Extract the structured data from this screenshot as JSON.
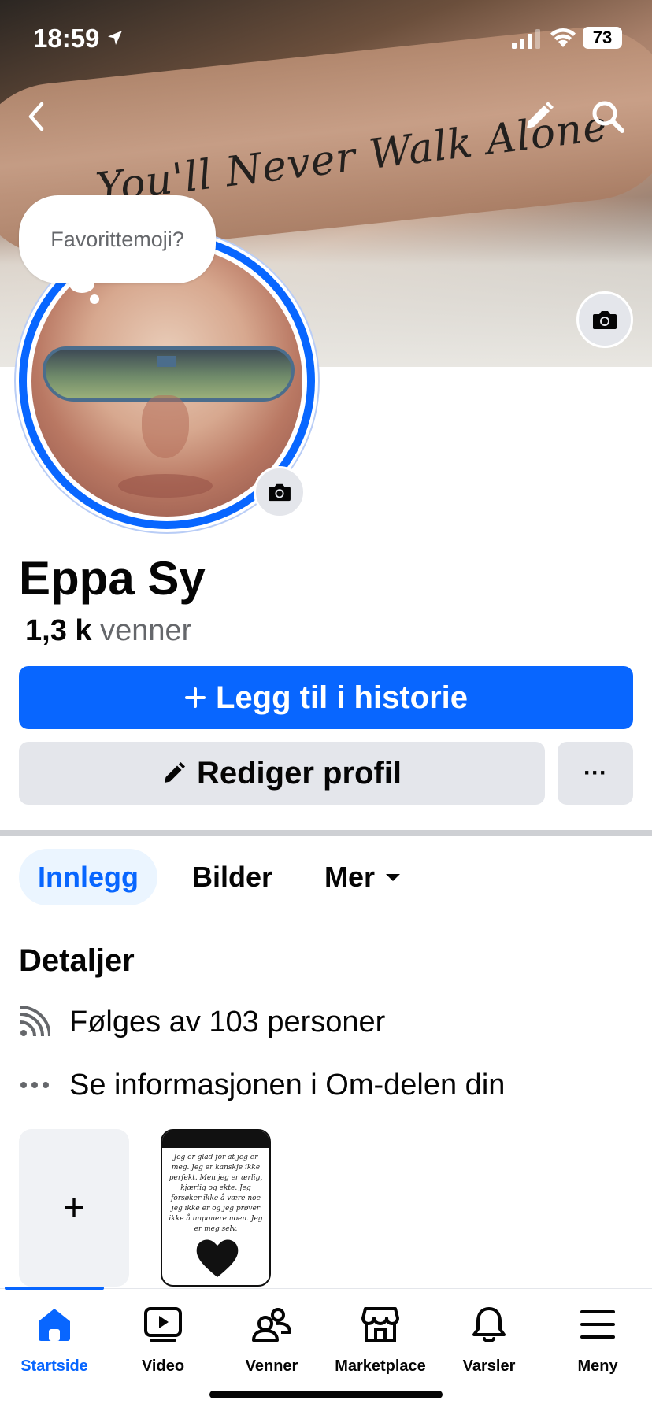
{
  "status_bar": {
    "time": "18:59",
    "battery": "73"
  },
  "cover": {
    "tattoo_text": "You'll Never Walk Alone"
  },
  "bubble": {
    "prompt": "Favorittemoji?"
  },
  "profile": {
    "name": "Eppa Sy",
    "friends_count": "1,3 k",
    "friends_label": "venner"
  },
  "actions": {
    "add_story": "Legg til i historie",
    "edit_profile": "Rediger profil",
    "more": "···"
  },
  "tabs": [
    {
      "label": "Innlegg",
      "active": true
    },
    {
      "label": "Bilder",
      "active": false
    },
    {
      "label": "Mer",
      "active": false
    }
  ],
  "details": {
    "title": "Detaljer",
    "followers": "Følges av 103 personer",
    "about": "Se informasjonen i Om-delen din"
  },
  "story": {
    "add_label": "+",
    "text": "Jeg er glad for at jeg er meg. Jeg er kanskje ikke perfekt. Men jeg er ærlig, kjærlig og ekte. Jeg forsøker ikke å være noe jeg ikke er og jeg prøver ikke å imponere noen. Jeg er meg selv."
  },
  "nav": [
    {
      "label": "Startside",
      "icon": "home-icon",
      "active": true
    },
    {
      "label": "Video",
      "icon": "video-icon",
      "active": false
    },
    {
      "label": "Venner",
      "icon": "friends-icon",
      "active": false
    },
    {
      "label": "Marketplace",
      "icon": "marketplace-icon",
      "active": false
    },
    {
      "label": "Varsler",
      "icon": "bell-icon",
      "active": false
    },
    {
      "label": "Meny",
      "icon": "menu-icon",
      "active": false
    }
  ],
  "colors": {
    "accent": "#0866ff",
    "button_gray": "#e4e6eb",
    "text_secondary": "#65676b"
  }
}
